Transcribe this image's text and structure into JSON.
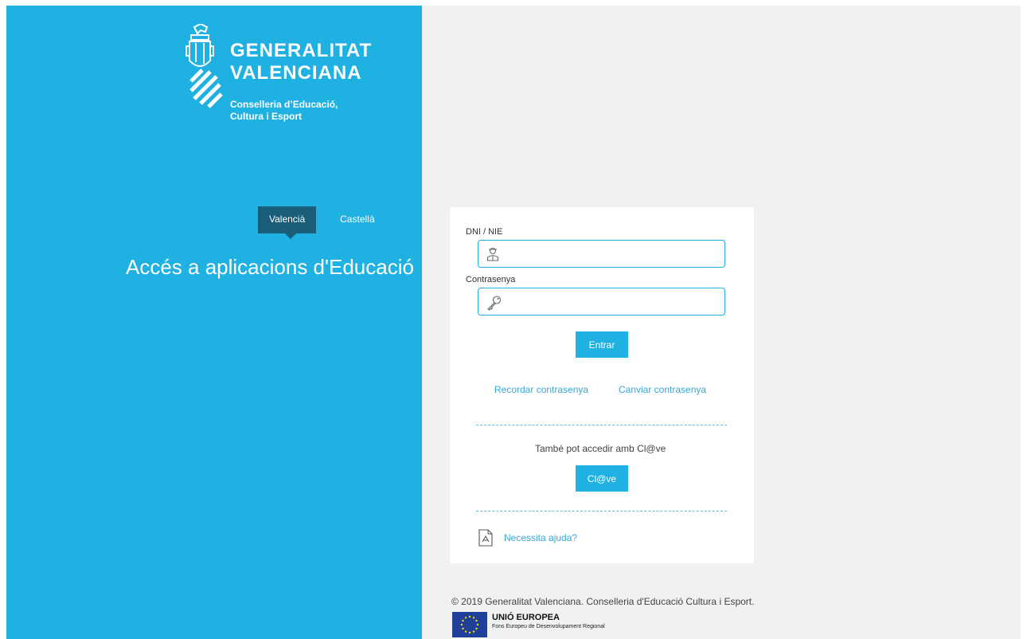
{
  "brand": {
    "line1": "GENERALITAT",
    "line2": "VALENCIANA",
    "sub1": "Conselleria d’Educació,",
    "sub2": "Cultura i Esport"
  },
  "language_tabs": {
    "active": "Valencià",
    "other": "Castellà"
  },
  "heading": "Accés a aplicacions d'Educació",
  "login_form": {
    "user_label": "DNI / NIE",
    "user_value": "",
    "password_label": "Contrasenya",
    "password_value": "",
    "submit_label": "Entrar",
    "remember_link": "Recordar contrasenya",
    "change_link": "Canviar contrasenya",
    "clave_text": "També pot accedir amb Cl@ve",
    "clave_button": "Cl@ve",
    "help_link": "Necessita ajuda?"
  },
  "footer": {
    "copyright": "© 2019 Generalitat Valenciana. Conselleria d'Educació Cultura i Esport.",
    "eu_title": "UNIÓ EUROPEA",
    "eu_subtitle": "Fons Europeu de Desenvolupament Regional"
  },
  "colors": {
    "brand_blue": "#1eb1e1",
    "active_tab": "#1a5d78",
    "link": "#36a8d8",
    "background": "#f1f1f1"
  },
  "icons": [
    "generalitat-emblem-icon",
    "user-icon",
    "key-icon",
    "pdf-icon",
    "eu-flag-icon"
  ]
}
